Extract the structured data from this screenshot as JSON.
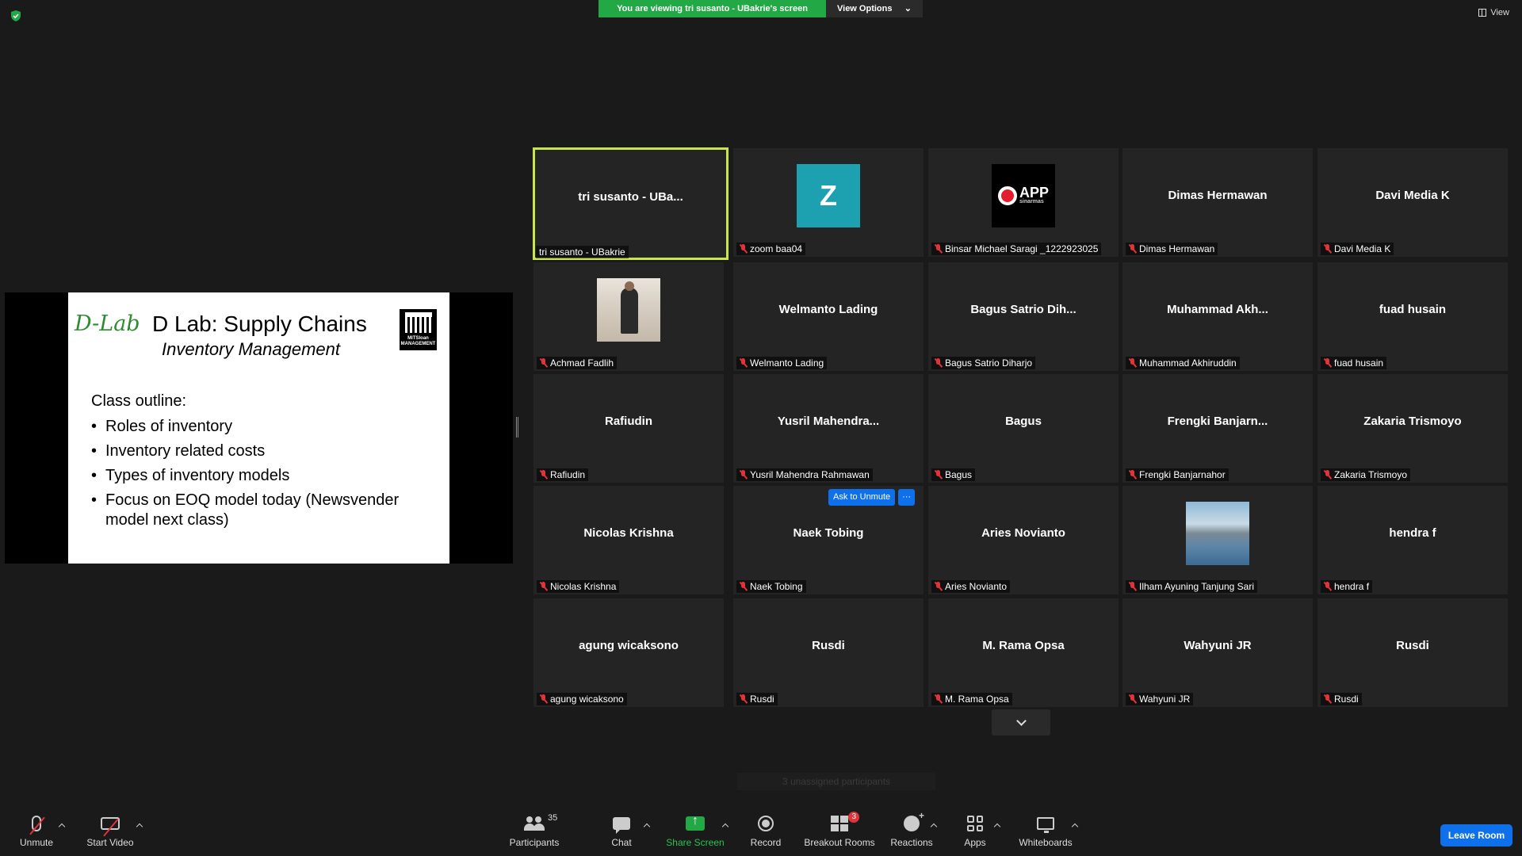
{
  "top": {
    "viewing_banner": "You are viewing tri susanto - UBakrie's screen",
    "view_options": "View Options",
    "view_button": "View"
  },
  "slide": {
    "logo": "D-Lab",
    "title": "D Lab: Supply Chains",
    "subtitle": "Inventory Management",
    "mit_logo_text": "MITSloan MANAGEMENT",
    "outline_heading": "Class outline:",
    "outline_items": [
      "Roles of inventory",
      "Inventory related costs",
      "Types of inventory models",
      "Focus on EOQ model today (Newsvender model next class)"
    ]
  },
  "gallery": {
    "tiles": [
      {
        "center": "tri susanto - UBa...",
        "name": "tri susanto - UBakrie"
      },
      {
        "center": "Z",
        "name": "zoom baa04"
      },
      {
        "center": "APP sinarmas",
        "name": "Binsar Michael Saragi _1222923025"
      },
      {
        "center": "Dimas Hermawan",
        "name": "Dimas Hermawan"
      },
      {
        "center": "Davi Media K",
        "name": "Davi Media K"
      },
      {
        "center": "",
        "name": "Achmad Fadlih"
      },
      {
        "center": "Welmanto Lading",
        "name": "Welmanto Lading"
      },
      {
        "center": "Bagus Satrio Dih...",
        "name": "Bagus Satrio Diharjo"
      },
      {
        "center": "Muhammad  Akh...",
        "name": "Muhammad Akhiruddin"
      },
      {
        "center": "fuad husain",
        "name": "fuad husain"
      },
      {
        "center": "Rafiudin",
        "name": "Rafiudin"
      },
      {
        "center": "Yusril  Mahendra...",
        "name": "Yusril Mahendra Rahmawan"
      },
      {
        "center": "Bagus",
        "name": "Bagus"
      },
      {
        "center": "Frengki  Banjarn...",
        "name": "Frengki Banjarnahor"
      },
      {
        "center": "Zakaria Trismoyo",
        "name": "Zakaria Trismoyo"
      },
      {
        "center": "Nicolas Krishna",
        "name": "Nicolas Krishna"
      },
      {
        "center": "Naek Tobing",
        "name": "Naek Tobing"
      },
      {
        "center": "Aries Novianto",
        "name": "Aries Novianto"
      },
      {
        "center": "",
        "name": "Ilham Ayuning Tanjung Sari"
      },
      {
        "center": "hendra f",
        "name": "hendra f"
      },
      {
        "center": "agung wicaksono",
        "name": "agung wicaksono"
      },
      {
        "center": "Rusdi",
        "name": "Rusdi"
      },
      {
        "center": "M. Rama Opsa",
        "name": "M. Rama Opsa"
      },
      {
        "center": "Wahyuni JR",
        "name": "Wahyuni JR"
      },
      {
        "center": "Rusdi",
        "name": "Rusdi"
      }
    ],
    "ask_to_unmute": "Ask to Unmute",
    "more": "···",
    "unassigned": "3 unassigned participants"
  },
  "toolbar": {
    "unmute": "Unmute",
    "start_video": "Start Video",
    "participants": "Participants",
    "participants_count": "35",
    "chat": "Chat",
    "share_screen": "Share Screen",
    "record": "Record",
    "breakout_rooms": "Breakout Rooms",
    "breakout_badge": "3",
    "reactions": "Reactions",
    "apps": "Apps",
    "whiteboards": "Whiteboards",
    "leave_room": "Leave Room"
  },
  "colors": {
    "active_speaker": "#c8e64b",
    "banner_green": "#23a846",
    "blue": "#0e71eb",
    "muted_red": "#e0333a"
  }
}
